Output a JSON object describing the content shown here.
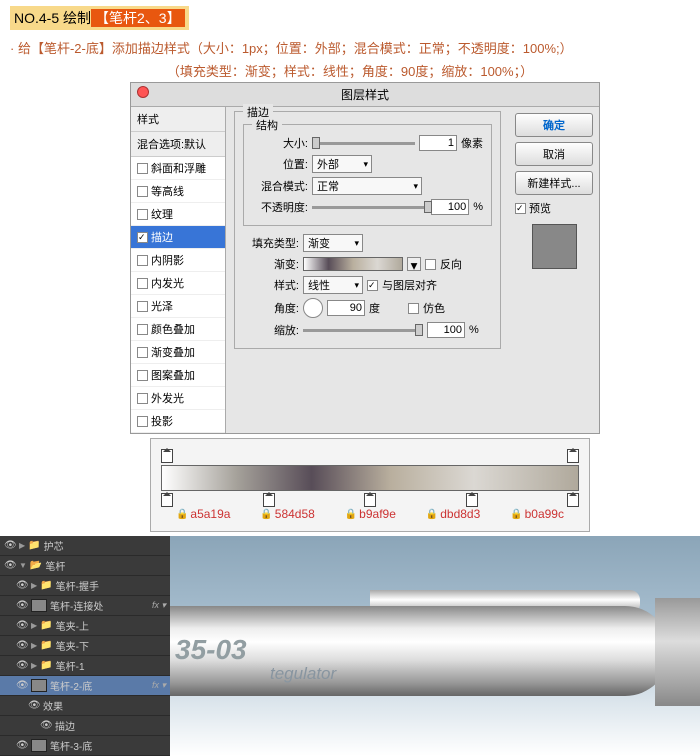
{
  "header": {
    "no": "NO.4-5 绘制",
    "highlight": "【笔杆2、3】",
    "desc1": "· 给【笔杆-2-底】添加描边样式（大小：1px；位置：外部；混合模式：正常；不透明度：100%;）",
    "desc2": "（填充类型：渐变；样式：线性；角度：90度；缩放：100%；）"
  },
  "dialog": {
    "title": "图层样式",
    "styles_header": "样式",
    "blend_default": "混合选项:默认",
    "items": [
      {
        "label": "斜面和浮雕",
        "checked": false
      },
      {
        "label": "等高线",
        "checked": false
      },
      {
        "label": "纹理",
        "checked": false
      },
      {
        "label": "描边",
        "checked": true,
        "selected": true
      },
      {
        "label": "内阴影",
        "checked": false
      },
      {
        "label": "内发光",
        "checked": false
      },
      {
        "label": "光泽",
        "checked": false
      },
      {
        "label": "颜色叠加",
        "checked": false
      },
      {
        "label": "渐变叠加",
        "checked": false
      },
      {
        "label": "图案叠加",
        "checked": false
      },
      {
        "label": "外发光",
        "checked": false
      },
      {
        "label": "投影",
        "checked": false
      }
    ],
    "stroke": {
      "group_title": "描边",
      "struct_title": "结构",
      "size_label": "大小:",
      "size_val": "1",
      "size_unit": "像素",
      "pos_label": "位置:",
      "pos_val": "外部",
      "blend_label": "混合模式:",
      "blend_val": "正常",
      "opacity_label": "不透明度:",
      "opacity_val": "100",
      "opacity_unit": "%",
      "fill_label": "填充类型:",
      "fill_val": "渐变",
      "grad_label": "渐变:",
      "reverse_label": "反向",
      "style_label": "样式:",
      "style_val": "线性",
      "align_label": "与图层对齐",
      "angle_label": "角度:",
      "angle_val": "90",
      "angle_unit": "度",
      "dither_label": "仿色",
      "scale_label": "缩放:",
      "scale_val": "100",
      "scale_unit": "%"
    },
    "buttons": {
      "ok": "确定",
      "cancel": "取消",
      "new_style": "新建样式...",
      "preview": "预览"
    }
  },
  "gradient": {
    "colors": [
      "a5a19a",
      "584d58",
      "b9af9e",
      "dbd8d3",
      "b0a99c"
    ]
  },
  "layers": {
    "items": [
      {
        "name": "护芯",
        "type": "folder",
        "indent": 0
      },
      {
        "name": "笔杆",
        "type": "folder",
        "indent": 0,
        "open": true
      },
      {
        "name": "笔杆-握手",
        "type": "folder",
        "indent": 1
      },
      {
        "name": "笔杆-连接处",
        "type": "layer",
        "indent": 1,
        "fx": true
      },
      {
        "name": "笔夹-上",
        "type": "folder",
        "indent": 1
      },
      {
        "name": "笔夹-下",
        "type": "folder",
        "indent": 1
      },
      {
        "name": "笔杆-1",
        "type": "folder",
        "indent": 1
      },
      {
        "name": "笔杆-2-底",
        "type": "layer",
        "indent": 1,
        "fx": true,
        "selected": true
      },
      {
        "name": "效果",
        "type": "fx",
        "indent": 2
      },
      {
        "name": "描边",
        "type": "fx",
        "indent": 3
      },
      {
        "name": "笔杆-3-底",
        "type": "layer",
        "indent": 1
      }
    ]
  },
  "canvas": {
    "text1": "35-03",
    "text2": "tegulator"
  },
  "chart_data": {
    "type": "table",
    "title": "Gradient color stops",
    "columns": [
      "hex"
    ],
    "rows": [
      [
        "a5a19a"
      ],
      [
        "584d58"
      ],
      [
        "b9af9e"
      ],
      [
        "dbd8d3"
      ],
      [
        "b0a99c"
      ]
    ]
  }
}
